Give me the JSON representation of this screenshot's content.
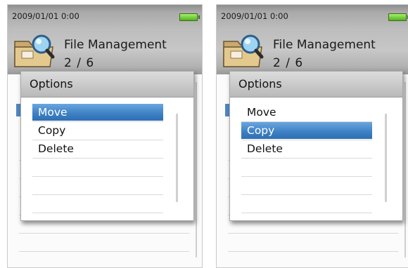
{
  "screens": [
    {
      "status_time": "2009/01/01  0:00",
      "app_title": "File Management",
      "page_counter": "2 / 6",
      "dialog": {
        "title": "Options",
        "options": [
          "Move",
          "Copy",
          "Delete"
        ],
        "selected_index": 0
      }
    },
    {
      "status_time": "2009/01/01  0:00",
      "app_title": "File Management",
      "page_counter": "2 / 6",
      "dialog": {
        "title": "Options",
        "options": [
          "Move",
          "Copy",
          "Delete"
        ],
        "selected_index": 1
      }
    }
  ],
  "colors": {
    "selection": "#3d7fc3",
    "battery": "#6fd13a"
  },
  "icons": [
    "folder-search-icon",
    "battery-icon"
  ]
}
